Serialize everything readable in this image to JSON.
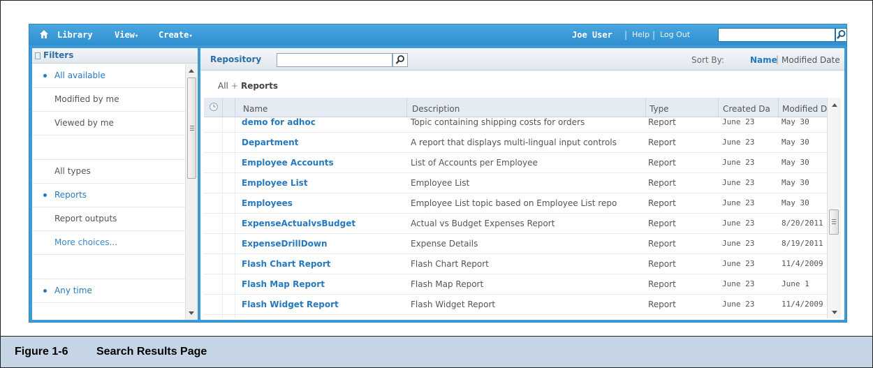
{
  "topbar": {
    "menus": [
      {
        "label": "Library",
        "has_caret": false
      },
      {
        "label": "View",
        "has_caret": true
      },
      {
        "label": "Create",
        "has_caret": true
      }
    ],
    "user": "Joe User",
    "help": "Help",
    "logout": "Log Out",
    "search_value": ""
  },
  "filters": {
    "title": "Filters",
    "items": [
      {
        "label": "All available",
        "state": "selected"
      },
      {
        "label": "Modified by me",
        "state": "normal"
      },
      {
        "label": "Viewed by me",
        "state": "normal"
      },
      {
        "label": "",
        "state": "blank"
      },
      {
        "label": "All types",
        "state": "normal"
      },
      {
        "label": "Reports",
        "state": "selected"
      },
      {
        "label": "Report outputs",
        "state": "normal"
      },
      {
        "label": "More choices...",
        "state": "link"
      },
      {
        "label": "",
        "state": "blank"
      },
      {
        "label": "Any time",
        "state": "selected"
      }
    ]
  },
  "repository": {
    "title": "Repository",
    "search_value": "",
    "sort_label": "Sort By:",
    "sort_name": "Name",
    "sort_modified": "Modified Date",
    "breadcrumb": {
      "root": "All",
      "current": "Reports"
    },
    "columns": [
      "Name",
      "Description",
      "Type",
      "Created Da",
      "Modified Da"
    ],
    "rows": [
      {
        "name": "demo for adhoc",
        "description": "Topic containing shipping costs for orders",
        "type": "Report",
        "created": "June 23",
        "modified": "May 30"
      },
      {
        "name": "Department",
        "description": "A report that displays multi-lingual input controls",
        "type": "Report",
        "created": "June 23",
        "modified": "May 30"
      },
      {
        "name": "Employee Accounts",
        "description": "List of Accounts per Employee",
        "type": "Report",
        "created": "June 23",
        "modified": "May 30"
      },
      {
        "name": "Employee List",
        "description": "Employee List",
        "type": "Report",
        "created": "June 23",
        "modified": "May 30"
      },
      {
        "name": "Employees",
        "description": "Employee List topic based on Employee List repo",
        "type": "Report",
        "created": "June 23",
        "modified": "May 30"
      },
      {
        "name": "ExpenseActualvsBudget",
        "description": "Actual vs Budget Expenses Report",
        "type": "Report",
        "created": "June 23",
        "modified": "8/20/2011"
      },
      {
        "name": "ExpenseDrillDown",
        "description": "Expense Details",
        "type": "Report",
        "created": "June 23",
        "modified": "8/19/2011"
      },
      {
        "name": "Flash Chart Report",
        "description": "Flash Chart Report",
        "type": "Report",
        "created": "June 23",
        "modified": "11/4/2009"
      },
      {
        "name": "Flash Map Report",
        "description": "Flash Map Report",
        "type": "Report",
        "created": "June 23",
        "modified": "June 1"
      },
      {
        "name": "Flash Widget Report",
        "description": "Flash Widget Report",
        "type": "Report",
        "created": "June 23",
        "modified": "11/4/2009"
      }
    ]
  },
  "caption": {
    "number": "Figure 1-6",
    "title": "Search Results Page"
  },
  "colors": {
    "accent": "#3c9ad6",
    "link": "#2779bf",
    "caption_bg": "#c6d5e6"
  }
}
